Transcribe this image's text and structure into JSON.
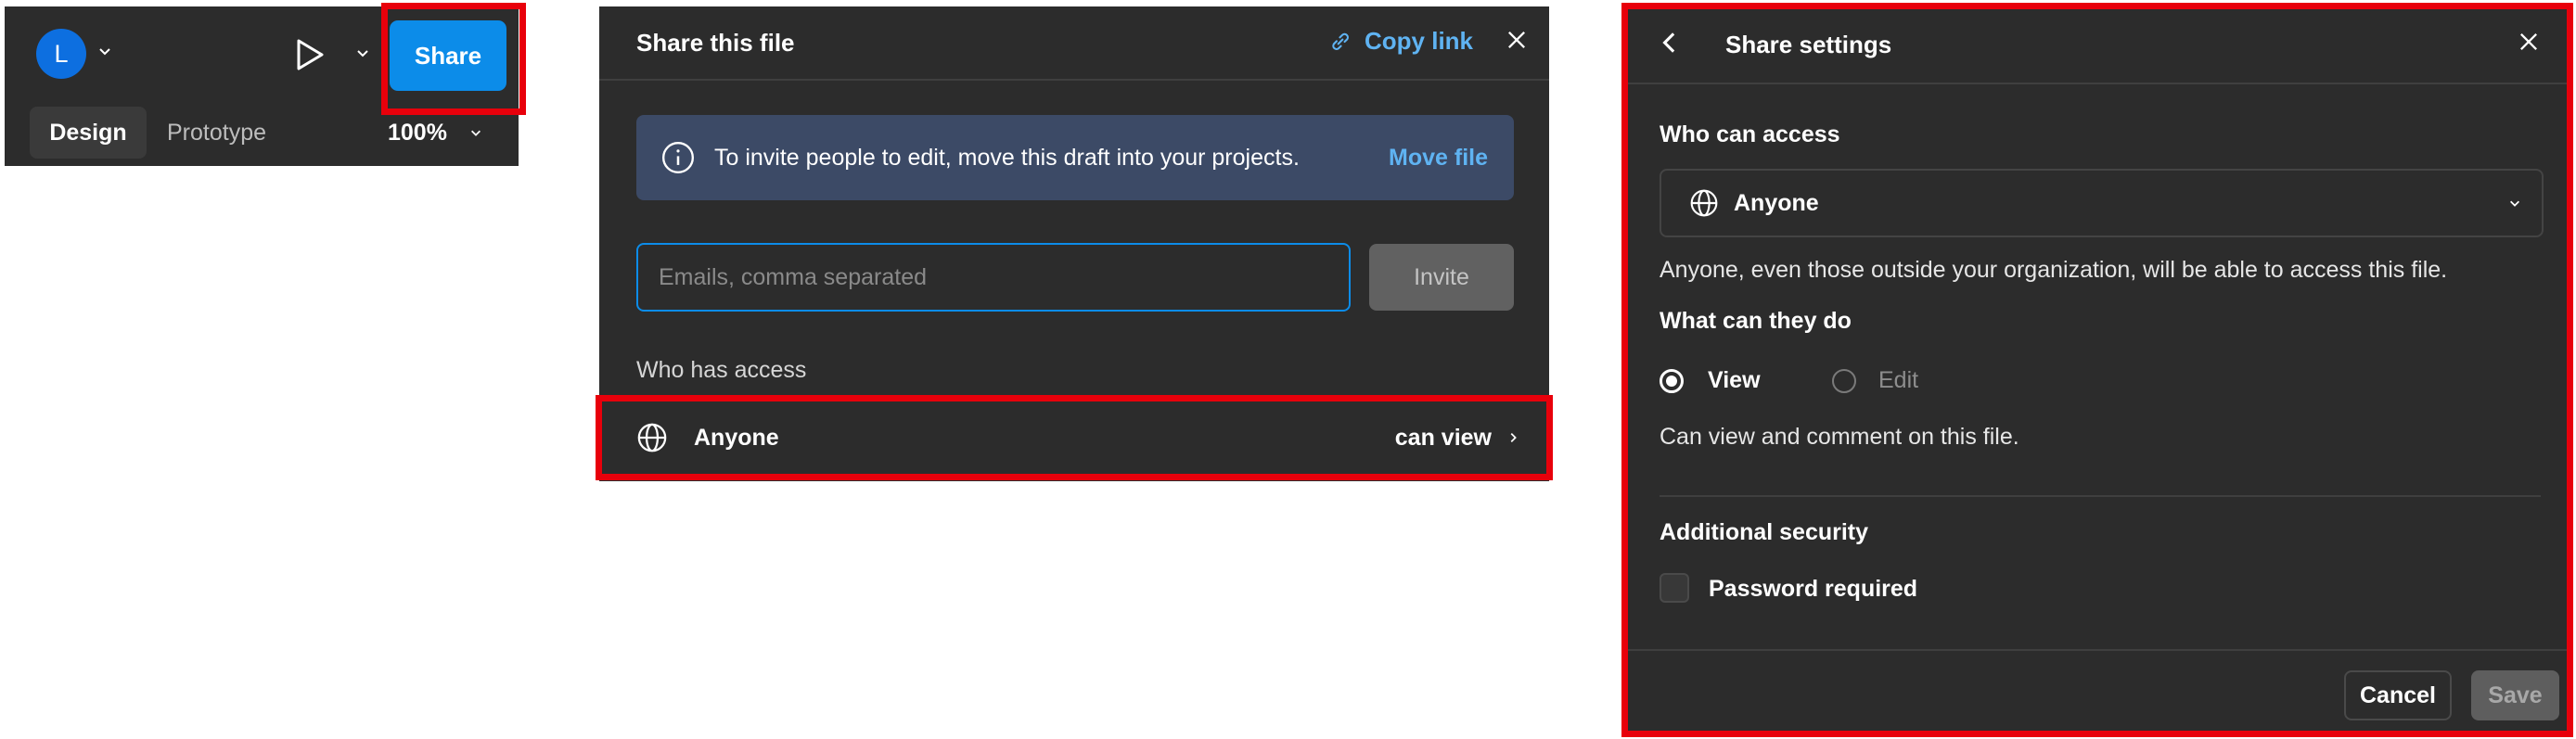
{
  "toolbar": {
    "avatar_letter": "L",
    "share_label": "Share",
    "tabs": [
      {
        "label": "Design",
        "active": true
      },
      {
        "label": "Prototype",
        "active": false
      }
    ],
    "zoom": "100%"
  },
  "share_dialog": {
    "title": "Share this file",
    "copy_link_label": "Copy link",
    "banner_text": "To invite people to edit, move this draft into your projects.",
    "banner_link": "Move file",
    "email_placeholder": "Emails, comma separated",
    "email_value": "",
    "invite_label": "Invite",
    "who_has_access_label": "Who has access",
    "access_entry": {
      "name": "Anyone",
      "permission": "can view"
    }
  },
  "share_settings": {
    "title": "Share settings",
    "who_can_access_label": "Who can access",
    "access_selected": "Anyone",
    "access_description": "Anyone, even those outside your organization, will be able to access this file.",
    "what_can_they_do_label": "What can they do",
    "options": [
      {
        "label": "View",
        "selected": true
      },
      {
        "label": "Edit",
        "selected": false
      }
    ],
    "option_description": "Can view and comment on this file.",
    "additional_security_label": "Additional security",
    "password_label": "Password required",
    "password_checked": false,
    "cancel_label": "Cancel",
    "save_label": "Save"
  },
  "colors": {
    "panel_bg": "#2c2c2c",
    "accent_blue": "#0c8ce9",
    "link_blue": "#5fb3f2",
    "highlight_red": "#e8000b",
    "banner_bg": "#3c4a66"
  }
}
